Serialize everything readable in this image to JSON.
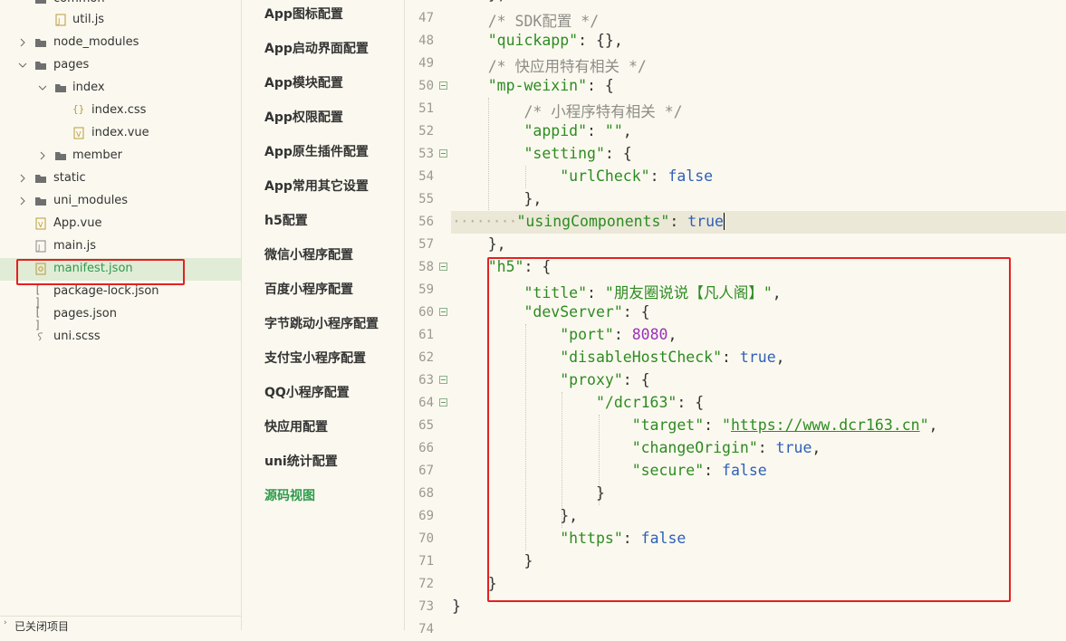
{
  "file_tree": {
    "items": [
      {
        "label": "common",
        "type": "folder"
      },
      {
        "label": "util.js",
        "type": "js"
      },
      {
        "label": "node_modules",
        "type": "folder"
      },
      {
        "label": "pages",
        "type": "folder"
      },
      {
        "label": "index",
        "type": "folder"
      },
      {
        "label": "index.css",
        "type": "css"
      },
      {
        "label": "index.vue",
        "type": "vue"
      },
      {
        "label": "member",
        "type": "folder"
      },
      {
        "label": "static",
        "type": "folder"
      },
      {
        "label": "uni_modules",
        "type": "folder"
      },
      {
        "label": "App.vue",
        "type": "vue"
      },
      {
        "label": "main.js",
        "type": "js"
      },
      {
        "label": "manifest.json",
        "type": "json",
        "selected": true
      },
      {
        "label": "package-lock.json",
        "type": "json"
      },
      {
        "label": "pages.json",
        "type": "json"
      },
      {
        "label": "uni.scss",
        "type": "scss"
      }
    ],
    "closed_projects": "已关闭项目"
  },
  "config_nav": {
    "items": [
      "App图标配置",
      "App启动界面配置",
      "App模块配置",
      "App权限配置",
      "App原生插件配置",
      "App常用其它设置",
      "h5配置",
      "微信小程序配置",
      "百度小程序配置",
      "字节跳动小程序配置",
      "支付宝小程序配置",
      "QQ小程序配置",
      "快应用配置",
      "uni统计配置",
      "源码视图"
    ],
    "active": "源码视图"
  },
  "editor": {
    "lines": [
      {
        "n": "47",
        "t": "    /* SDK配置 */"
      },
      {
        "n": "48",
        "t": "    \"quickapp\": {},"
      },
      {
        "n": "49",
        "t": "    /* 快应用特有相关 */"
      },
      {
        "n": "50",
        "t": "    \"mp-weixin\": {"
      },
      {
        "n": "51",
        "t": "        /* 小程序特有相关 */"
      },
      {
        "n": "52",
        "t": "        \"appid\": \"\","
      },
      {
        "n": "53",
        "t": "        \"setting\": {"
      },
      {
        "n": "54",
        "t": "            \"urlCheck\": false"
      },
      {
        "n": "55",
        "t": "        },"
      },
      {
        "n": "56",
        "t": "        \"usingComponents\": true"
      },
      {
        "n": "57",
        "t": "    },"
      },
      {
        "n": "58",
        "t": "    \"h5\": {"
      },
      {
        "n": "59",
        "t": "        \"title\": \"朋友圈说说【凡人阁】\","
      },
      {
        "n": "60",
        "t": "        \"devServer\": {"
      },
      {
        "n": "61",
        "t": "            \"port\": 8080,"
      },
      {
        "n": "62",
        "t": "            \"disableHostCheck\": true,"
      },
      {
        "n": "63",
        "t": "            \"proxy\": {"
      },
      {
        "n": "64",
        "t": "                \"/dcr163\": {"
      },
      {
        "n": "65",
        "t": "                    \"target\": \"https://www.dcr163.cn\","
      },
      {
        "n": "66",
        "t": "                    \"changeOrigin\": true,"
      },
      {
        "n": "67",
        "t": "                    \"secure\": false"
      },
      {
        "n": "68",
        "t": "                }"
      },
      {
        "n": "69",
        "t": "            },"
      },
      {
        "n": "70",
        "t": "            \"https\": false"
      },
      {
        "n": "71",
        "t": "        }"
      },
      {
        "n": "72",
        "t": "    }"
      },
      {
        "n": "73",
        "t": "}"
      },
      {
        "n": "74",
        "t": ""
      }
    ],
    "top_partial": "},",
    "colors": {
      "key": "#2e8b22",
      "comment": "#8e8e88",
      "bool": "#2f5fb8",
      "number": "#9b2fb8",
      "highlight_box": "#e52020"
    }
  }
}
